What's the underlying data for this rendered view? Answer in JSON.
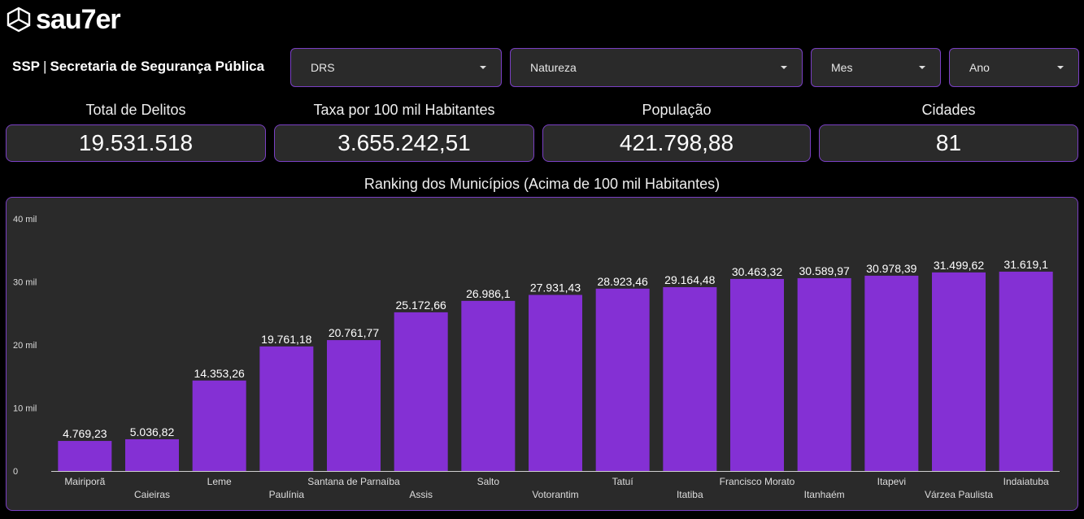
{
  "brand": {
    "name": "sau7er"
  },
  "app": {
    "title_short": "SSP",
    "separator": "|",
    "title_full": "Secretaria de Segurança Pública"
  },
  "filters": [
    {
      "label": "DRS"
    },
    {
      "label": "Natureza"
    },
    {
      "label": "Mes"
    },
    {
      "label": "Ano"
    }
  ],
  "kpis": [
    {
      "label": "Total de Delitos",
      "value": "19.531.518"
    },
    {
      "label": "Taxa por 100 mil Habitantes",
      "value": "3.655.242,51"
    },
    {
      "label": "População",
      "value": "421.798,88"
    },
    {
      "label": "Cidades",
      "value": "81"
    }
  ],
  "colors": {
    "accent": "#7a3fc4",
    "bar": "#8430d4",
    "panel": "#2a2a2a",
    "background": "#000000"
  },
  "chart_data": {
    "type": "bar",
    "title": "Ranking dos Municípios (Acima de 100 mil Habitantes)",
    "categories": [
      "Mairiporã",
      "Caieiras",
      "Leme",
      "Paulínia",
      "Santana de Parnaíba",
      "Assis",
      "Salto",
      "Votorantim",
      "Tatuí",
      "Itatiba",
      "Francisco Morato",
      "Itanhaém",
      "Itapevi",
      "Várzea Paulista",
      "Indaiatuba"
    ],
    "values": [
      4769.23,
      5036.82,
      14353.26,
      19761.18,
      20761.77,
      25172.66,
      26986.1,
      27931.43,
      28923.46,
      29164.48,
      30463.32,
      30589.97,
      30978.39,
      31499.62,
      31619.1
    ],
    "data_labels": [
      "4.769,23",
      "5.036,82",
      "14.353,26",
      "19.761,18",
      "20.761,77",
      "25.172,66",
      "26.986,1",
      "27.931,43",
      "28.923,46",
      "29.164,48",
      "30.463,32",
      "30.589,97",
      "30.978,39",
      "31.499,62",
      "31.619,1"
    ],
    "ylim": [
      0,
      40000
    ],
    "yticks": [
      0,
      10000,
      20000,
      30000,
      40000
    ],
    "ytick_labels": [
      "0",
      "10 mil",
      "20 mil",
      "30 mil",
      "40 mil"
    ],
    "grid": false,
    "legend": "none"
  }
}
